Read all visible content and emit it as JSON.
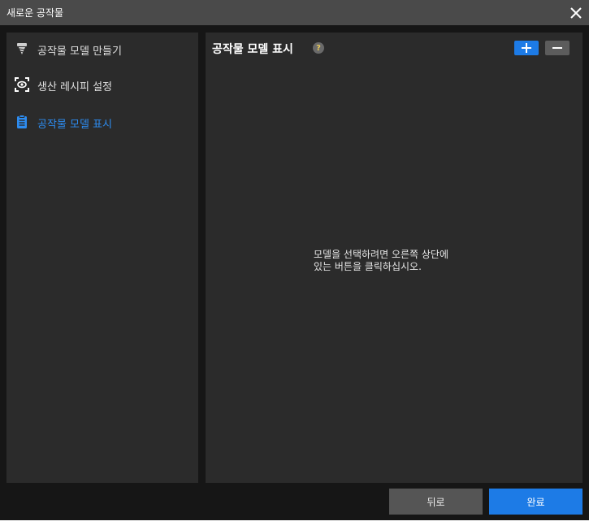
{
  "window": {
    "title": "새로운 공작물"
  },
  "sidebar": {
    "items": [
      {
        "label": "공작물 모델 만들기",
        "icon": "screw-icon",
        "active": false
      },
      {
        "label": "생산 레시피 설정",
        "icon": "eye-scan-icon",
        "active": false
      },
      {
        "label": "공작물 모델 표시",
        "icon": "clipboard-icon",
        "active": true
      }
    ]
  },
  "panel": {
    "title": "공작물 모델 표시",
    "help": "?",
    "empty_message": {
      "line1": "모델을 선택하려면 오른쪽 상단에",
      "line2": "있는 버튼을 클릭하십시오."
    }
  },
  "footer": {
    "back_label": "뒤로",
    "done_label": "완료"
  },
  "colors": {
    "accent": "#1d7be6",
    "active_text": "#2d8cf0",
    "background": "#161616",
    "panel": "#2b2b2b",
    "titlebar": "#4a4a4a"
  }
}
